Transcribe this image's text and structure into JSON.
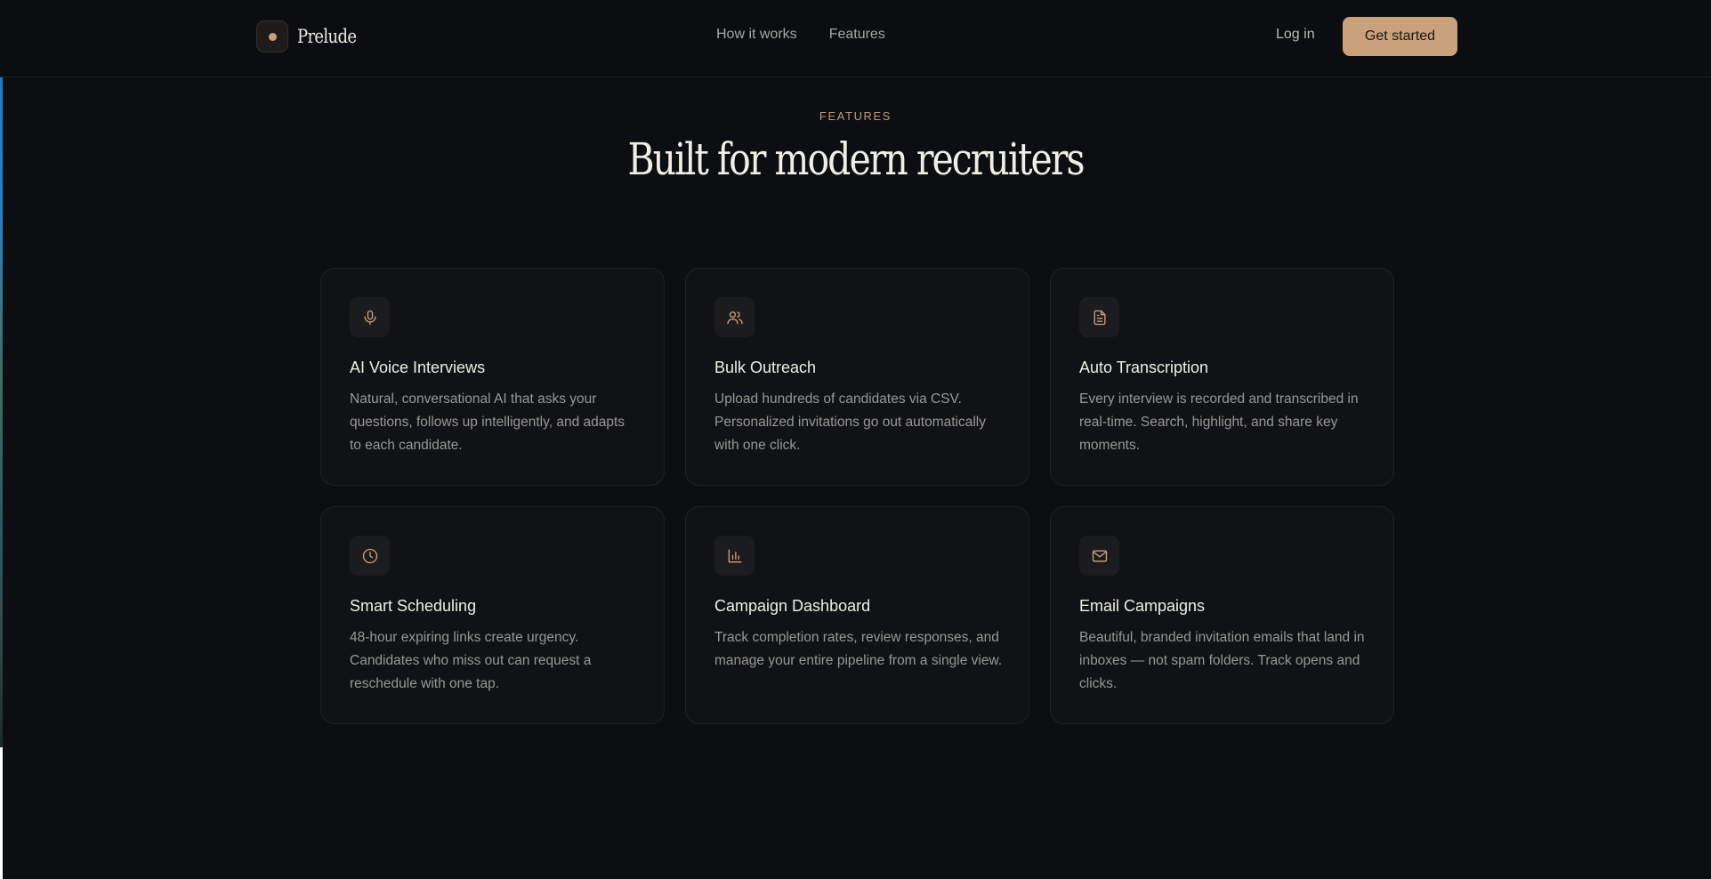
{
  "brand": {
    "name": "Prelude",
    "accent_color": "#c9a27b"
  },
  "nav": {
    "items": [
      {
        "label": "How it works"
      },
      {
        "label": "Features"
      }
    ],
    "login_label": "Log in",
    "cta_label": "Get started"
  },
  "section": {
    "eyebrow": "FEATURES",
    "title": "Built for modern recruiters"
  },
  "features": [
    {
      "icon": "microphone-icon",
      "title": "AI Voice Interviews",
      "description": "Natural, conversational AI that asks your questions, follows up intelligently, and adapts to each candidate."
    },
    {
      "icon": "users-icon",
      "title": "Bulk Outreach",
      "description": "Upload hundreds of candidates via CSV. Personalized invitations go out automatically with one click."
    },
    {
      "icon": "document-icon",
      "title": "Auto Transcription",
      "description": "Every interview is recorded and transcribed in real-time. Search, highlight, and share key moments."
    },
    {
      "icon": "clock-icon",
      "title": "Smart Scheduling",
      "description": "48-hour expiring links create urgency. Candidates who miss out can request a reschedule with one tap."
    },
    {
      "icon": "bar-chart-icon",
      "title": "Campaign Dashboard",
      "description": "Track completion rates, review responses, and manage your entire pipeline from a single view."
    },
    {
      "icon": "mail-icon",
      "title": "Email Campaigns",
      "description": "Beautiful, branded invitation emails that land in inboxes — not spam folders. Track opens and clicks."
    }
  ]
}
